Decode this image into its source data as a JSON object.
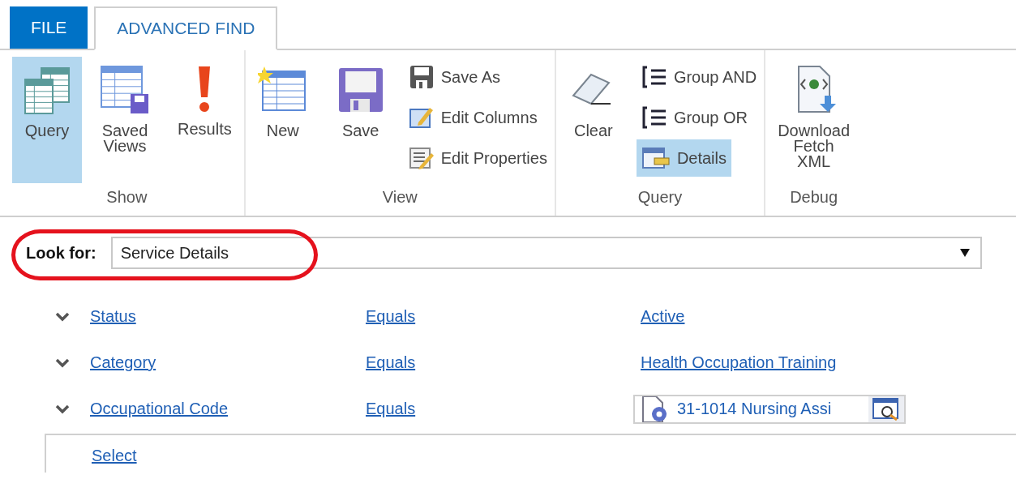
{
  "tabs": [
    {
      "label": "FILE",
      "kind": "file",
      "selected": false
    },
    {
      "label": "ADVANCED FIND",
      "kind": "tab",
      "selected": true
    }
  ],
  "ribbon": {
    "groups": [
      {
        "label": "Show",
        "buttons": [
          {
            "label": "Query",
            "kind": "large",
            "selected": true
          },
          {
            "label": "Saved Views",
            "kind": "large",
            "selected": false
          },
          {
            "label": "Results",
            "kind": "large",
            "selected": false
          }
        ]
      },
      {
        "label": "View",
        "buttons": [
          {
            "label": "New",
            "kind": "large",
            "selected": false
          },
          {
            "label": "Save",
            "kind": "large",
            "selected": false
          },
          {
            "label": "Save As",
            "kind": "small",
            "selected": false
          },
          {
            "label": "Edit Columns",
            "kind": "small",
            "selected": false
          },
          {
            "label": "Edit Properties",
            "kind": "small",
            "selected": false
          }
        ]
      },
      {
        "label": "Query",
        "buttons": [
          {
            "label": "Clear",
            "kind": "large",
            "selected": false
          },
          {
            "label": "Group AND",
            "kind": "small",
            "selected": false
          },
          {
            "label": "Group OR",
            "kind": "small",
            "selected": false
          },
          {
            "label": "Details",
            "kind": "small",
            "selected": true
          }
        ]
      },
      {
        "label": "Debug",
        "buttons": [
          {
            "label": "Download Fetch XML",
            "kind": "large",
            "selected": false
          }
        ]
      }
    ]
  },
  "look_for": {
    "label": "Look for:",
    "value": "Service Details"
  },
  "conditions": [
    {
      "field": "Status",
      "operator": "Equals",
      "value": "Active",
      "kind": "link"
    },
    {
      "field": "Category",
      "operator": "Equals",
      "value": "Health Occupation Training",
      "kind": "link"
    },
    {
      "field": "Occupational Code",
      "operator": "Equals",
      "value": "31-1014 Nursing Assi",
      "kind": "lookup"
    }
  ],
  "select_link": "Select"
}
